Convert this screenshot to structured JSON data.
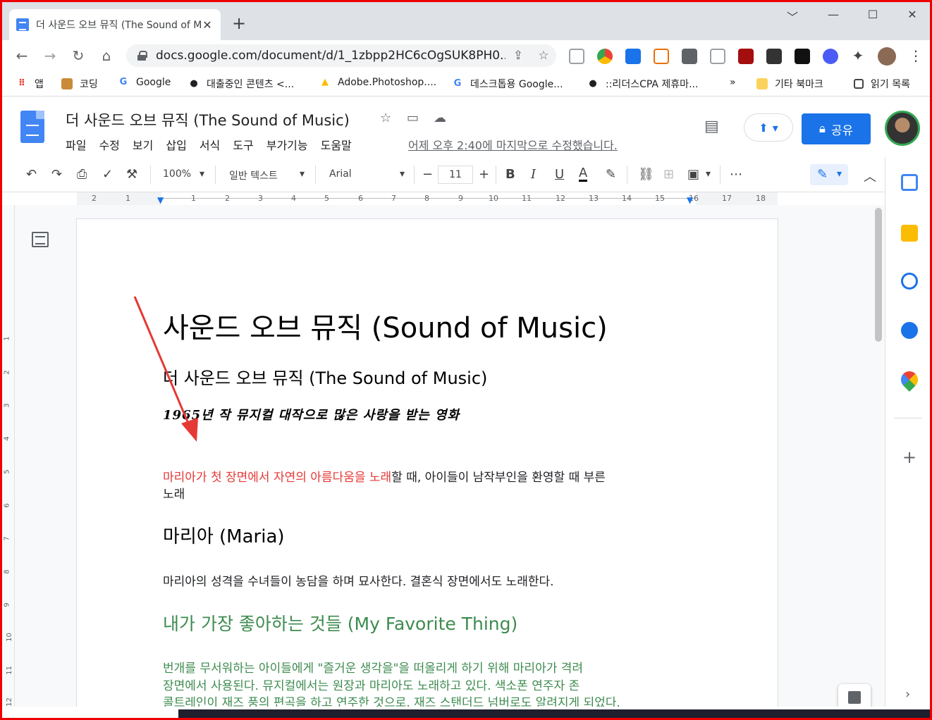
{
  "browser": {
    "tab_title": "더 사운드 오브 뮤직 (The Sound of Music)",
    "tab_close": "✕",
    "new_tab": "+",
    "url": "docs.google.com/document/d/1_1zbpp2HC6cOgSUK8PH0...",
    "window_controls": [
      "﹀",
      "—",
      "☐",
      "✕"
    ]
  },
  "bookmarks": [
    {
      "label": "앱",
      "icon": "apps-grid-icon",
      "color": "#ea4335"
    },
    {
      "label": "코딩",
      "icon": "dog-icon",
      "color": "#c98a3a"
    },
    {
      "label": "Google",
      "icon": "google-g-icon",
      "color": "#4285f4"
    },
    {
      "label": "대출중인 콘텐츠 <...",
      "icon": "globe-icon",
      "color": "#202124"
    },
    {
      "label": "Adobe.Photoshop....",
      "icon": "drive-icon",
      "color": "#fbbc04"
    },
    {
      "label": "데스크톱용 Google...",
      "icon": "google-g-icon",
      "color": "#4285f4"
    },
    {
      "label": "::리더스CPA 제휴마...",
      "icon": "globe-icon",
      "color": "#202124"
    },
    {
      "label": "»",
      "icon": "",
      "color": ""
    },
    {
      "label": "기타 북마크",
      "icon": "folder-icon",
      "color": "#fbd25c"
    },
    {
      "label": "읽기 목록",
      "icon": "reading-list-icon",
      "color": "#202124"
    }
  ],
  "docs": {
    "title": "더 사운드 오브 뮤직 (The Sound of Music)",
    "menus": [
      "파일",
      "수정",
      "보기",
      "삽입",
      "서식",
      "도구",
      "부가기능",
      "도움말"
    ],
    "last_edit": "어제 오후 2:40에 마지막으로 수정했습니다.",
    "share_label": "공유",
    "accent": "#1a73e8"
  },
  "toolbar": {
    "zoom": "100%",
    "style": "일반 텍스트",
    "font": "Arial",
    "font_size": "11",
    "bold": "B",
    "italic": "I",
    "underline": "U",
    "text_color": "A",
    "more": "⋯"
  },
  "ruler": {
    "labels": [
      "2",
      "1",
      "1",
      "2",
      "3",
      "4",
      "5",
      "6",
      "7",
      "8",
      "9",
      "10",
      "11",
      "12",
      "13",
      "14",
      "15",
      "16",
      "17",
      "18"
    ],
    "vlabels": [
      "1",
      "2",
      "3",
      "4",
      "5",
      "6",
      "7",
      "8",
      "9",
      "10",
      "11",
      "12"
    ]
  },
  "document": {
    "title": "사운드 오브 뮤직 (Sound of Music)",
    "subtitle": "더 사운드 오브 뮤직 (The Sound of Music)",
    "handwritten": "1965년 작 뮤지컬 대작으로 많은 사랑을 받는 영화",
    "para1_red": "마리아가 첫 장면에서 자연의 아름다움을 노래",
    "para1_rest": "할 때, 아이들이 남작부인을 환영할 때 부른",
    "para1_line2": "노래",
    "h_maria": "마리아 (Maria)",
    "para_maria": "마리아의 성격을 수녀들이 농담을 하며 묘사한다. 결혼식 장면에서도 노래한다.",
    "h_fav": "내가 가장 좋아하는 것들 (My Favorite Thing)",
    "fav_l1": "번개를 무서워하는 아이들에게 \"즐거운 생각을\"을 떠올리게 하기 위해 마리아가 격려",
    "fav_l2": "장면에서 사용된다. 뮤지컬에서는 원장과 마리아도 노래하고 있다. 색소폰 연주자 존",
    "fav_l3": "콜트레인이 재즈 풍의 편곡을 하고 연주한 것으로, 재즈 스탠더드 넘버로도 알려지게 되었다.",
    "red": "#e53935",
    "green": "#3d8b4f"
  }
}
